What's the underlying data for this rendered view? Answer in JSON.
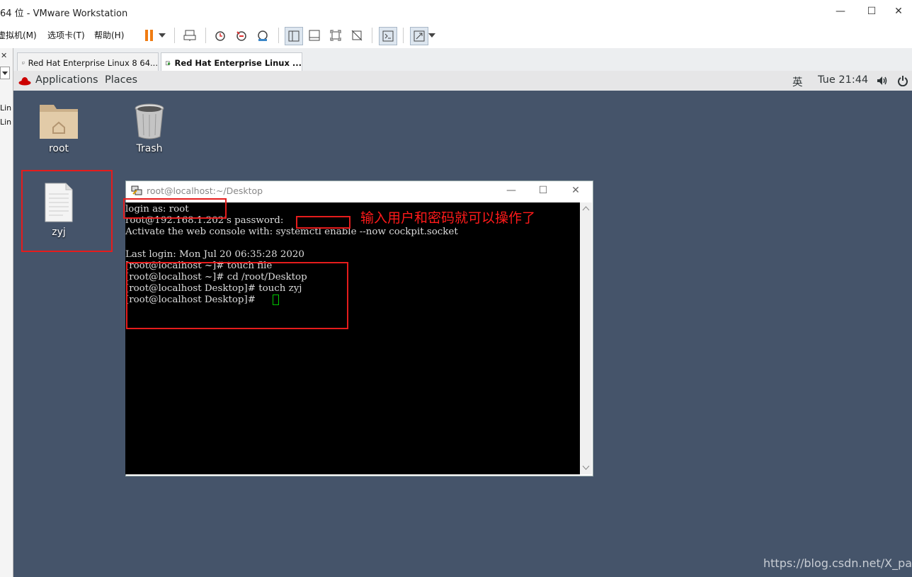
{
  "window": {
    "title": "64 位 - VMware Workstation",
    "controls": {
      "minimize": "—",
      "maximize": "☐",
      "close": "✕"
    }
  },
  "menu": {
    "items": [
      "虚拟机(M)",
      "选项卡(T)",
      "帮助(H)"
    ]
  },
  "library": {
    "close": "✕",
    "items": [
      "Lin",
      "Lin"
    ]
  },
  "tabs": [
    {
      "label": "Red Hat Enterprise Linux 8 64...",
      "active": false
    },
    {
      "label": "Red Hat Enterprise Linux ...",
      "active": true
    }
  ],
  "gnome": {
    "applications": "Applications",
    "places": "Places",
    "input_method": "英",
    "clock": "Tue 21:44"
  },
  "desktop": {
    "icons": [
      {
        "label": "root",
        "type": "home-folder"
      },
      {
        "label": "Trash",
        "type": "trash"
      },
      {
        "label": "zyj",
        "type": "text-file"
      }
    ]
  },
  "terminal": {
    "title": "root@localhost:~/Desktop",
    "lines": [
      "login as: root",
      "root@192.168.1.202's password:",
      "Activate the web console with: systemctl enable --now cockpit.socket",
      "",
      "Last login: Mon Jul 20 06:35:28 2020",
      "[root@localhost ~]# touch file",
      "[root@localhost ~]# cd /root/Desktop",
      "[root@localhost Desktop]# touch zyj",
      "[root@localhost Desktop]# "
    ]
  },
  "annotation": {
    "text": "输入用户和密码就可以操作了",
    "color": "#e51c1c"
  },
  "watermark": "https://blog.csdn.net/X_pang",
  "colors": {
    "desktop": "#45546a",
    "terminal_bg": "#000000",
    "cursor": "#00c800"
  }
}
